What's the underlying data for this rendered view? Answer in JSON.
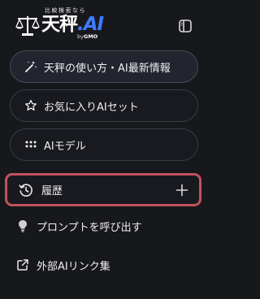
{
  "header": {
    "logo_tagline": "比較検索なら",
    "logo_kanji": "天秤",
    "logo_ai": ".AI",
    "logo_by": "by",
    "logo_gmo": "GMO",
    "logo_icon": "balance-scale-icon",
    "toggle_icon": "sidebar-toggle-icon"
  },
  "menu": {
    "primary_label": "天秤の使い方・AI最新情報",
    "primary_icon": "magic-wand-icon",
    "favorites_label": "お気に入りAIセット",
    "favorites_icon": "star-icon",
    "models_label": "AIモデル",
    "models_icon": "grid-dots-icon"
  },
  "history": {
    "label": "履歴",
    "icon": "history-clock-icon",
    "add_icon": "plus-icon"
  },
  "links": {
    "prompt_label": "プロンプトを呼び出す",
    "prompt_icon": "lightbulb-icon",
    "external_label": "外部AIリンク集",
    "external_icon": "external-link-icon"
  },
  "colors": {
    "background": "#17181c",
    "accent": "#3d7bff",
    "highlight_border": "#c2525e"
  }
}
